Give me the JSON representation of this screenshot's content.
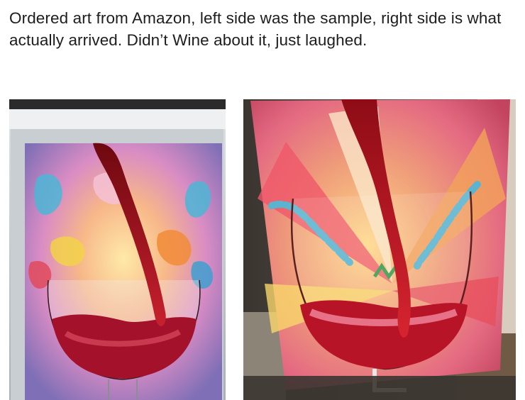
{
  "post": {
    "caption": "Ordered art from Amazon, left side was the sample, right side is what actually arrived. Didn’t Wine about it, just laughed."
  },
  "images": [
    {
      "name": "sample-painting",
      "description_icon": "wine-glass-painting"
    },
    {
      "name": "delivered-painting",
      "description_icon": "wine-glass-painting"
    }
  ],
  "colors": {
    "wine_red": "#a0101c",
    "background": "#ffffff",
    "text": "#1d1d1d"
  }
}
